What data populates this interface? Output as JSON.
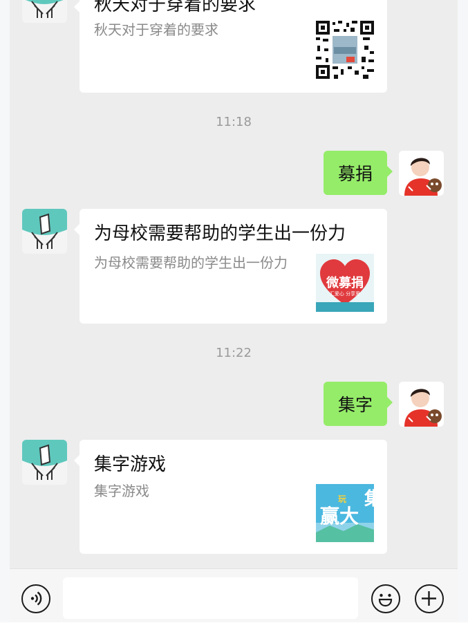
{
  "messages": [
    {
      "type": "card",
      "title": "秋天对于穿着的要求",
      "desc": "秋天对于穿着的要求",
      "thumb": "qr-code"
    },
    {
      "type": "time",
      "text": "11:18"
    },
    {
      "type": "mine",
      "text": "募捐"
    },
    {
      "type": "card",
      "title": "为母校需要帮助的学生出一份力",
      "desc": "为母校需要帮助的学生出一份力",
      "thumb": "donation-poster",
      "thumb_text": "微募捐",
      "thumb_sub": "汇爱心 分享爱"
    },
    {
      "type": "time",
      "text": "11:22"
    },
    {
      "type": "mine",
      "text": "集字"
    },
    {
      "type": "card",
      "title": "集字游戏",
      "desc": "集字游戏",
      "thumb": "game-poster",
      "thumb_text": "赢大",
      "thumb_small": "玩",
      "thumb_right": "集"
    }
  ],
  "input_bar": {
    "voice_icon": "voice-icon",
    "emoji_icon": "emoji-icon",
    "add_icon": "plus-icon",
    "placeholder": ""
  },
  "colors": {
    "my_bubble": "#95ec69",
    "chat_bg": "#ededed",
    "card_bg": "#ffffff"
  }
}
